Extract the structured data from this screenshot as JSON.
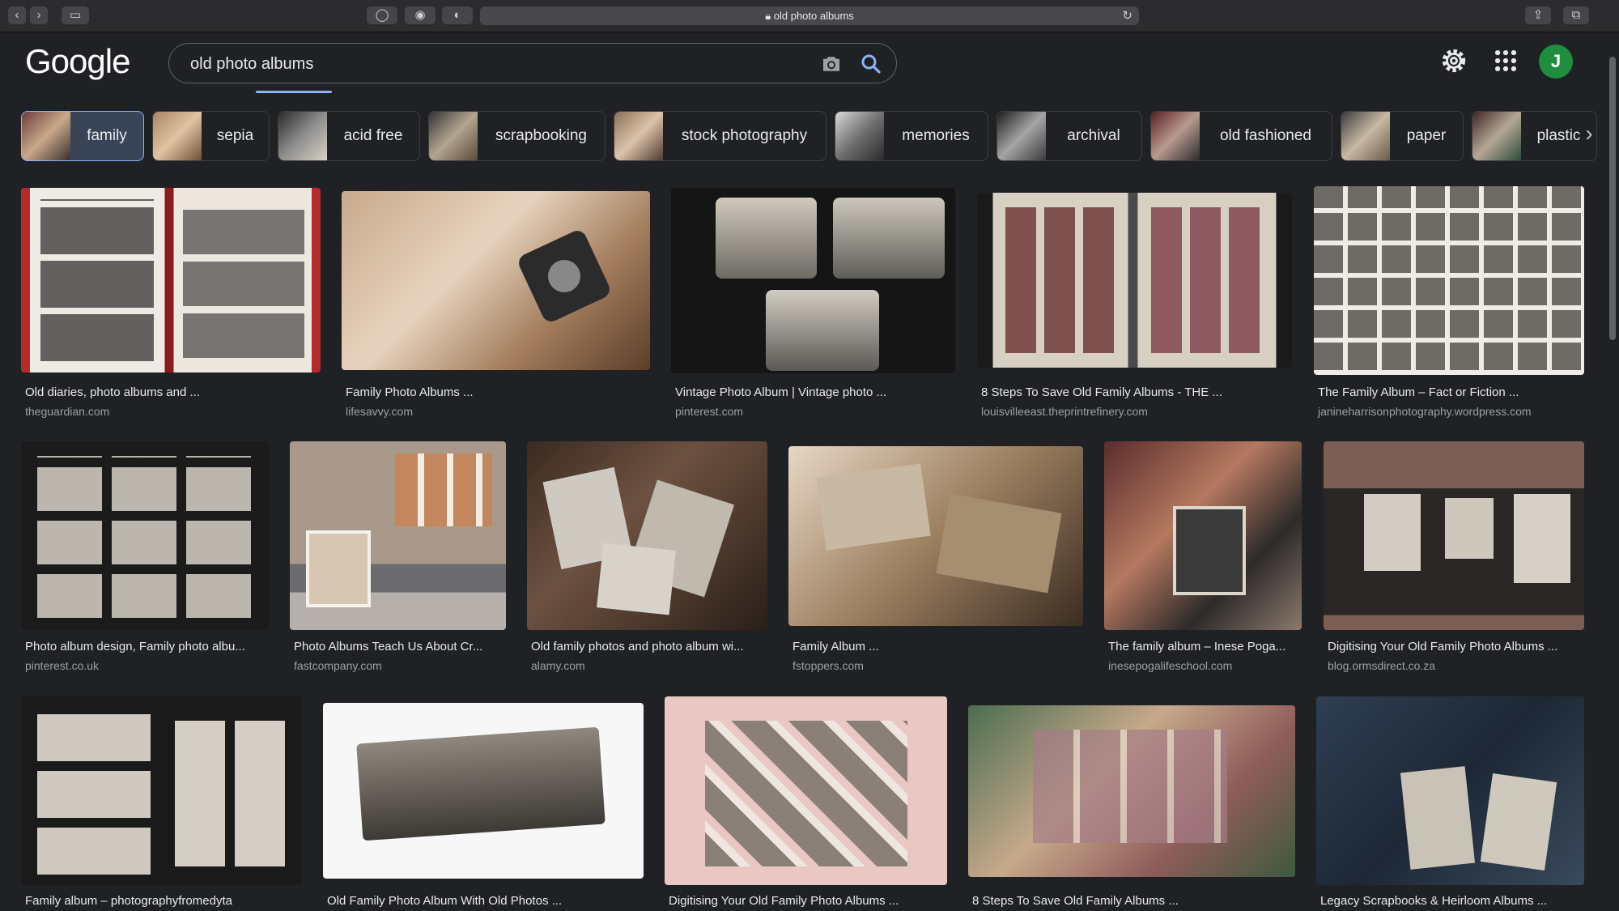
{
  "browser": {
    "url": "old photo albums"
  },
  "header": {
    "logo": "Google",
    "search_value": "old photo albums",
    "avatar_letter": "J"
  },
  "chips": [
    {
      "label": "family",
      "active": true
    },
    {
      "label": "sepia"
    },
    {
      "label": "acid free"
    },
    {
      "label": "scrapbooking"
    },
    {
      "label": "stock photography"
    },
    {
      "label": "memories"
    },
    {
      "label": "archival"
    },
    {
      "label": "old fashioned"
    },
    {
      "label": "paper"
    },
    {
      "label": "plastic"
    }
  ],
  "results": [
    {
      "title": "Old diaries, photo albums and ...",
      "source": "theguardian.com"
    },
    {
      "title": "Family Photo Albums ...",
      "source": "lifesavvy.com"
    },
    {
      "title": "Vintage Photo Album | Vintage photo ...",
      "source": "pinterest.com"
    },
    {
      "title": "8 Steps To Save Old Family Albums - THE ...",
      "source": "louisvilleeast.theprintrefinery.com"
    },
    {
      "title": "The Family Album – Fact or Fiction ...",
      "source": "janineharrisonphotography.wordpress.com"
    },
    {
      "title": "Photo album design, Family photo albu...",
      "source": "pinterest.co.uk"
    },
    {
      "title": "Photo Albums Teach Us About Cr...",
      "source": "fastcompany.com"
    },
    {
      "title": "Old family photos and photo album wi...",
      "source": "alamy.com"
    },
    {
      "title": "Family Album ...",
      "source": "fstoppers.com"
    },
    {
      "title": "The family album – Inese Poga...",
      "source": "inesepogalifeschool.com"
    },
    {
      "title": "Digitising Your Old Family Photo Albums ...",
      "source": "blog.ormsdirect.co.za"
    },
    {
      "title": "Family album – photographyfromedyta",
      "source": ""
    },
    {
      "title": "Old Family Photo Album With Old Photos ...",
      "source": ""
    },
    {
      "title": "Digitising Your Old Family Photo Albums ...",
      "source": ""
    },
    {
      "title": "8 Steps To Save Old Family Albums ...",
      "source": ""
    },
    {
      "title": "Legacy Scrapbooks & Heirloom Albums ...",
      "source": ""
    }
  ]
}
